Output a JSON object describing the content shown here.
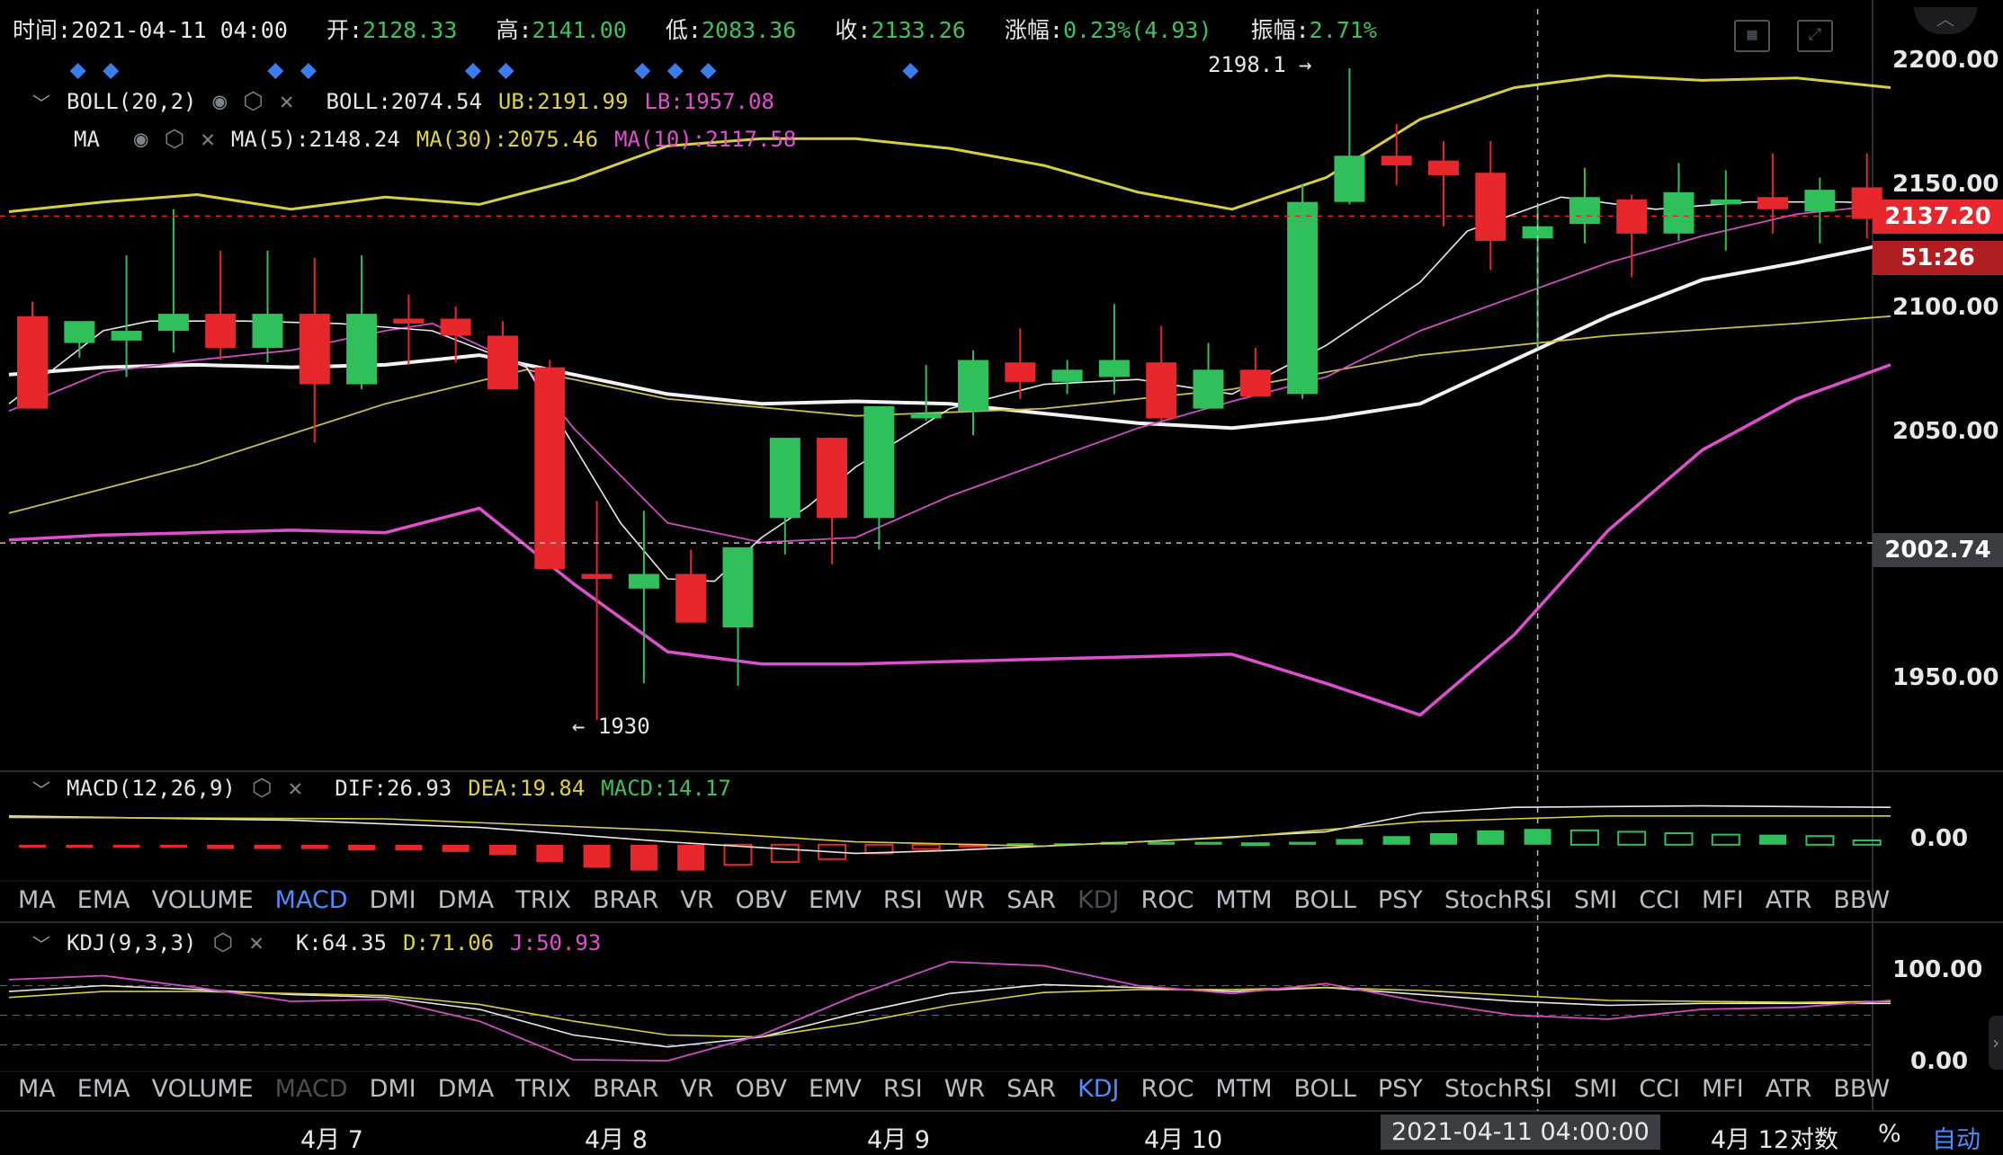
{
  "info": {
    "time_label": "时间:",
    "time": "2021-04-11 04:00",
    "open_label": "开:",
    "open": "2128.33",
    "high_label": "高:",
    "high": "2141.00",
    "low_label": "低:",
    "low": "2083.36",
    "close_label": "收:",
    "close": "2133.26",
    "change_label": "涨幅:",
    "change": "0.23%(4.93)",
    "amp_label": "振幅:",
    "amp": "2.71%"
  },
  "boll_legend": {
    "name": "BOLL(20,2)",
    "boll": "BOLL:2074.54",
    "ub": "UB:2191.99",
    "lb": "LB:1957.08"
  },
  "ma_legend": {
    "name": "MA",
    "ma5": "MA(5):2148.24",
    "ma30": "MA(30):2075.46",
    "ma10": "MA(10):2117.58"
  },
  "macd_legend": {
    "name": "MACD(12,26,9)",
    "dif": "DIF:26.93",
    "dea": "DEA:19.84",
    "macd": "MACD:14.17"
  },
  "kdj_legend": {
    "name": "KDJ(9,3,3)",
    "k": "K:64.35",
    "d": "D:71.06",
    "j": "J:50.93"
  },
  "annotations": {
    "high_note": "2198.1 →",
    "low_note": "← 1930"
  },
  "tabs": [
    "MA",
    "EMA",
    "VOLUME",
    "MACD",
    "DMI",
    "DMA",
    "TRIX",
    "BRAR",
    "VR",
    "OBV",
    "EMV",
    "RSI",
    "WR",
    "SAR",
    "KDJ",
    "ROC",
    "MTM",
    "BOLL",
    "PSY",
    "StochRSI",
    "SMI",
    "CCI",
    "MFI",
    "ATR",
    "BBW"
  ],
  "tabs_row1_active": "MACD",
  "tabs_row1_disabled": "KDJ",
  "tabs_row2_active": "KDJ",
  "tabs_row2_disabled": "MACD",
  "price_axis": [
    "2200.00",
    "2150.00",
    "2100.00",
    "2050.00",
    "1950.00"
  ],
  "macd_axis": [
    "0.00"
  ],
  "kdj_axis": [
    "100.00",
    "0.00"
  ],
  "tags": {
    "last_price": "2137.20",
    "countdown": "51:26",
    "crosshair_price": "2002.74"
  },
  "x_axis": {
    "labels": [
      "4月 7",
      "4月 8",
      "4月 9",
      "4月 10",
      "4月 12"
    ],
    "crosshair_time": "2021-04-11 04:00:00",
    "log_label": "对数",
    "pct_label": "%",
    "auto_label": "自动"
  },
  "colors": {
    "up": "#2fbf5b",
    "down": "#e8272d",
    "boll_ub": "#d7cf3c",
    "boll_lb": "#e04fd0",
    "boll_mid": "#f2f2f2",
    "accent": "#4e8cff"
  },
  "chart_data": {
    "type": "candlestick",
    "ylim": [
      1910,
      2212
    ],
    "candles": [
      {
        "o": 2096,
        "h": 2102,
        "l": 2058,
        "c": 2058
      },
      {
        "o": 2085,
        "h": 2092,
        "l": 2079,
        "c": 2094
      },
      {
        "o": 2086,
        "h": 2121,
        "l": 2071,
        "c": 2090
      },
      {
        "o": 2090,
        "h": 2140,
        "l": 2081,
        "c": 2097
      },
      {
        "o": 2097,
        "h": 2123,
        "l": 2078,
        "c": 2083
      },
      {
        "o": 2083,
        "h": 2123,
        "l": 2077,
        "c": 2097
      },
      {
        "o": 2097,
        "h": 2120,
        "l": 2044,
        "c": 2068
      },
      {
        "o": 2068,
        "h": 2121,
        "l": 2066,
        "c": 2097
      },
      {
        "o": 2095,
        "h": 2105,
        "l": 2076,
        "c": 2093
      },
      {
        "o": 2095,
        "h": 2100,
        "l": 2077,
        "c": 2088
      },
      {
        "o": 2088,
        "h": 2094,
        "l": 2068,
        "c": 2066
      },
      {
        "o": 2075,
        "h": 2078,
        "l": 1993,
        "c": 1992
      },
      {
        "o": 1990,
        "h": 2020,
        "l": 1930,
        "c": 1988
      },
      {
        "o": 1984,
        "h": 2016,
        "l": 1945,
        "c": 1990
      },
      {
        "o": 1990,
        "h": 2000,
        "l": 1970,
        "c": 1970
      },
      {
        "o": 1968,
        "h": 1998,
        "l": 1944,
        "c": 2001
      },
      {
        "o": 2013,
        "h": 2034,
        "l": 1998,
        "c": 2046
      },
      {
        "o": 2046,
        "h": 2036,
        "l": 1994,
        "c": 2013
      },
      {
        "o": 2013,
        "h": 2052,
        "l": 2000,
        "c": 2059
      },
      {
        "o": 2054,
        "h": 2076,
        "l": 2053,
        "c": 2056
      },
      {
        "o": 2057,
        "h": 2082,
        "l": 2047,
        "c": 2078
      },
      {
        "o": 2077,
        "h": 2091,
        "l": 2062,
        "c": 2069
      },
      {
        "o": 2069,
        "h": 2078,
        "l": 2064,
        "c": 2074
      },
      {
        "o": 2071,
        "h": 2101,
        "l": 2064,
        "c": 2078
      },
      {
        "o": 2077,
        "h": 2092,
        "l": 2053,
        "c": 2054
      },
      {
        "o": 2058,
        "h": 2085,
        "l": 2060,
        "c": 2074
      },
      {
        "o": 2074,
        "h": 2083,
        "l": 2065,
        "c": 2063
      },
      {
        "o": 2064,
        "h": 2150,
        "l": 2062,
        "c": 2143
      },
      {
        "o": 2143,
        "h": 2198,
        "l": 2142,
        "c": 2162
      },
      {
        "o": 2162,
        "h": 2175,
        "l": 2150,
        "c": 2158
      },
      {
        "o": 2160,
        "h": 2168,
        "l": 2133,
        "c": 2154
      },
      {
        "o": 2155,
        "h": 2168,
        "l": 2115,
        "c": 2127
      },
      {
        "o": 2128,
        "h": 2141,
        "l": 2083,
        "c": 2133
      },
      {
        "o": 2134,
        "h": 2157,
        "l": 2126,
        "c": 2145
      },
      {
        "o": 2144,
        "h": 2146,
        "l": 2112,
        "c": 2130
      },
      {
        "o": 2130,
        "h": 2159,
        "l": 2127,
        "c": 2147
      },
      {
        "o": 2142,
        "h": 2156,
        "l": 2123,
        "c": 2144
      },
      {
        "o": 2145,
        "h": 2163,
        "l": 2130,
        "c": 2140
      },
      {
        "o": 2139,
        "h": 2153,
        "l": 2126,
        "c": 2148
      },
      {
        "o": 2149,
        "h": 2163,
        "l": 2128,
        "c": 2136
      }
    ],
    "boll_ub": [
      [
        0,
        2139
      ],
      [
        2,
        2143
      ],
      [
        4,
        2146
      ],
      [
        6,
        2140
      ],
      [
        8,
        2145
      ],
      [
        10,
        2142
      ],
      [
        12,
        2152
      ],
      [
        14,
        2166
      ],
      [
        16,
        2169
      ],
      [
        18,
        2169
      ],
      [
        20,
        2165
      ],
      [
        22,
        2158
      ],
      [
        24,
        2147
      ],
      [
        26,
        2140
      ],
      [
        28,
        2153
      ],
      [
        30,
        2177
      ],
      [
        32,
        2190
      ],
      [
        34,
        2195
      ],
      [
        36,
        2193
      ],
      [
        38,
        2194
      ],
      [
        40,
        2190
      ]
    ],
    "boll_mid": [
      [
        0,
        2072
      ],
      [
        2,
        2075
      ],
      [
        4,
        2076
      ],
      [
        6,
        2075
      ],
      [
        8,
        2076
      ],
      [
        10,
        2080
      ],
      [
        12,
        2072
      ],
      [
        14,
        2064
      ],
      [
        16,
        2060
      ],
      [
        18,
        2061
      ],
      [
        20,
        2060
      ],
      [
        22,
        2056
      ],
      [
        24,
        2052
      ],
      [
        26,
        2050
      ],
      [
        28,
        2054
      ],
      [
        30,
        2060
      ],
      [
        32,
        2078
      ],
      [
        34,
        2096
      ],
      [
        36,
        2111
      ],
      [
        38,
        2118
      ],
      [
        40,
        2126
      ]
    ],
    "boll_lb": [
      [
        0,
        2004
      ],
      [
        2,
        2006
      ],
      [
        4,
        2007
      ],
      [
        6,
        2008
      ],
      [
        8,
        2007
      ],
      [
        10,
        2017
      ],
      [
        12,
        1986
      ],
      [
        14,
        1958
      ],
      [
        16,
        1953
      ],
      [
        18,
        1953
      ],
      [
        20,
        1954
      ],
      [
        22,
        1955
      ],
      [
        24,
        1956
      ],
      [
        26,
        1957
      ],
      [
        28,
        1945
      ],
      [
        30,
        1932
      ],
      [
        32,
        1965
      ],
      [
        34,
        2008
      ],
      [
        36,
        2041
      ],
      [
        38,
        2062
      ],
      [
        40,
        2076
      ]
    ],
    "ma5": [
      [
        0,
        2060
      ],
      [
        2,
        2090
      ],
      [
        3,
        2094
      ],
      [
        5,
        2094
      ],
      [
        7,
        2093
      ],
      [
        9,
        2090
      ],
      [
        11,
        2075
      ],
      [
        13,
        2011
      ],
      [
        14,
        1988
      ],
      [
        15,
        1987
      ],
      [
        16,
        2005
      ],
      [
        17,
        2018
      ],
      [
        18,
        2034
      ],
      [
        20,
        2058
      ],
      [
        22,
        2068
      ],
      [
        24,
        2070
      ],
      [
        26,
        2064
      ],
      [
        28,
        2084
      ],
      [
        30,
        2110
      ],
      [
        31,
        2131
      ],
      [
        33,
        2145
      ],
      [
        35,
        2140
      ],
      [
        37,
        2143
      ],
      [
        39,
        2143
      ],
      [
        40,
        2142
      ]
    ],
    "ma10": [
      [
        0,
        2057
      ],
      [
        2,
        2073
      ],
      [
        4,
        2078
      ],
      [
        6,
        2082
      ],
      [
        8,
        2090
      ],
      [
        9,
        2093
      ],
      [
        11,
        2075
      ],
      [
        12,
        2050
      ],
      [
        14,
        2011
      ],
      [
        16,
        2003
      ],
      [
        18,
        2005
      ],
      [
        20,
        2022
      ],
      [
        22,
        2036
      ],
      [
        24,
        2050
      ],
      [
        26,
        2061
      ],
      [
        28,
        2071
      ],
      [
        30,
        2090
      ],
      [
        32,
        2104
      ],
      [
        34,
        2118
      ],
      [
        36,
        2129
      ],
      [
        38,
        2138
      ],
      [
        40,
        2142
      ]
    ],
    "ma30": [
      [
        0,
        2015
      ],
      [
        4,
        2035
      ],
      [
        8,
        2060
      ],
      [
        11,
        2074
      ],
      [
        14,
        2062
      ],
      [
        18,
        2055
      ],
      [
        22,
        2058
      ],
      [
        26,
        2066
      ],
      [
        30,
        2080
      ],
      [
        34,
        2088
      ],
      [
        38,
        2093
      ],
      [
        40,
        2096
      ]
    ],
    "macd": {
      "ylim": [
        -22,
        28
      ],
      "hist": [
        -2,
        -2,
        -2,
        -2,
        -3,
        -3,
        -3,
        -4,
        -4,
        -5,
        -7,
        -12,
        -16,
        -18,
        -18,
        -14,
        -12,
        -10,
        -6,
        -3,
        -1,
        1,
        1,
        2,
        2,
        2,
        1,
        2,
        4,
        6,
        8,
        10,
        11,
        10,
        9,
        8,
        7,
        7,
        6,
        3
      ],
      "dif": [
        [
          0,
          20
        ],
        [
          6,
          17
        ],
        [
          10,
          12
        ],
        [
          14,
          2
        ],
        [
          18,
          -6
        ],
        [
          20,
          -4
        ],
        [
          24,
          2
        ],
        [
          28,
          9
        ],
        [
          30,
          22
        ],
        [
          32,
          26
        ],
        [
          36,
          27
        ],
        [
          40,
          26
        ]
      ],
      "dea": [
        [
          0,
          19
        ],
        [
          8,
          18
        ],
        [
          14,
          10
        ],
        [
          18,
          2
        ],
        [
          22,
          -1
        ],
        [
          26,
          5
        ],
        [
          30,
          16
        ],
        [
          34,
          20
        ],
        [
          38,
          20
        ],
        [
          40,
          20
        ]
      ]
    },
    "kdj": {
      "ylim": [
        -5,
        115
      ],
      "dashed": [
        80,
        50,
        20
      ],
      "k": [
        [
          0,
          74
        ],
        [
          2,
          80
        ],
        [
          4,
          76
        ],
        [
          6,
          71
        ],
        [
          8,
          68
        ],
        [
          10,
          56
        ],
        [
          12,
          30
        ],
        [
          14,
          18
        ],
        [
          16,
          28
        ],
        [
          18,
          52
        ],
        [
          20,
          72
        ],
        [
          22,
          81
        ],
        [
          24,
          78
        ],
        [
          26,
          74
        ],
        [
          28,
          78
        ],
        [
          30,
          71
        ],
        [
          32,
          64
        ],
        [
          34,
          60
        ],
        [
          36,
          62
        ],
        [
          38,
          62
        ],
        [
          40,
          62
        ]
      ],
      "d": [
        [
          0,
          68
        ],
        [
          2,
          74
        ],
        [
          4,
          74
        ],
        [
          6,
          72
        ],
        [
          8,
          70
        ],
        [
          10,
          61
        ],
        [
          12,
          44
        ],
        [
          14,
          30
        ],
        [
          16,
          28
        ],
        [
          18,
          42
        ],
        [
          20,
          60
        ],
        [
          22,
          73
        ],
        [
          24,
          76
        ],
        [
          26,
          76
        ],
        [
          28,
          78
        ],
        [
          30,
          75
        ],
        [
          32,
          70
        ],
        [
          34,
          65
        ],
        [
          36,
          64
        ],
        [
          38,
          63
        ],
        [
          40,
          64
        ]
      ],
      "j": [
        [
          0,
          86
        ],
        [
          2,
          90
        ],
        [
          4,
          78
        ],
        [
          6,
          64
        ],
        [
          8,
          66
        ],
        [
          10,
          44
        ],
        [
          12,
          5
        ],
        [
          14,
          4
        ],
        [
          16,
          30
        ],
        [
          18,
          70
        ],
        [
          20,
          104
        ],
        [
          22,
          100
        ],
        [
          24,
          80
        ],
        [
          26,
          72
        ],
        [
          28,
          82
        ],
        [
          30,
          64
        ],
        [
          32,
          50
        ],
        [
          34,
          46
        ],
        [
          36,
          56
        ],
        [
          38,
          58
        ],
        [
          40,
          65
        ]
      ]
    }
  }
}
